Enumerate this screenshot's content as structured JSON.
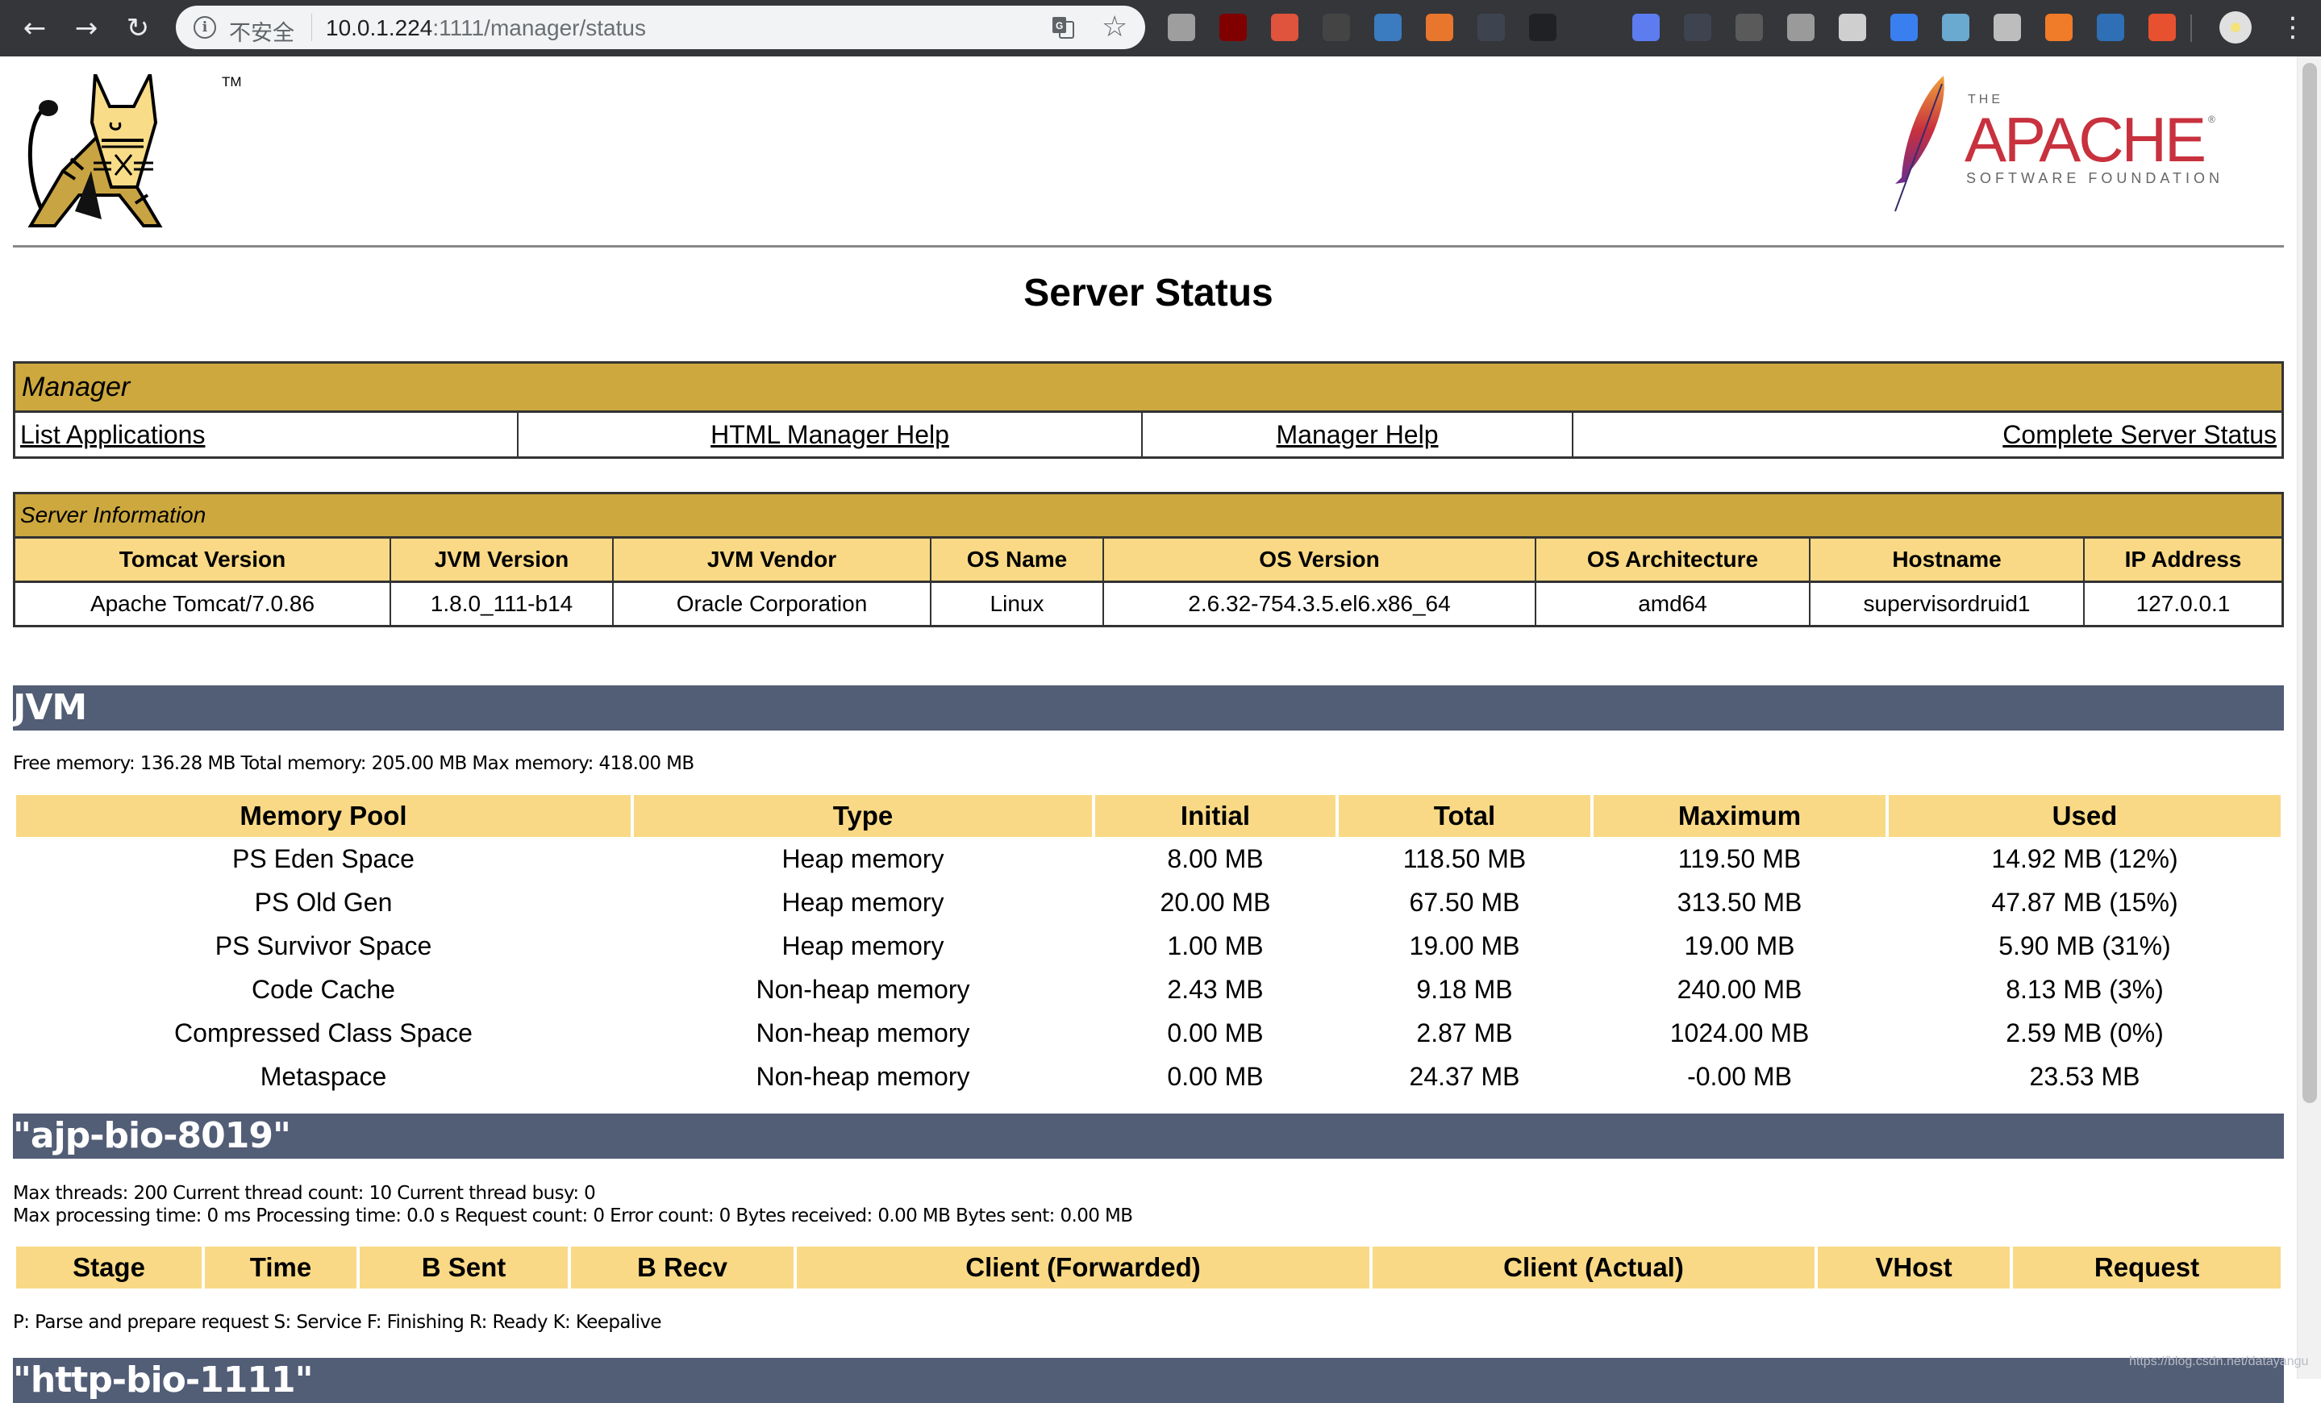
{
  "browser": {
    "back_icon": "arrow-left-icon",
    "forward_icon": "arrow-right-icon",
    "reload_icon": "reload-icon",
    "security_label": "不安全",
    "url_host": "10.0.1.224",
    "url_rest": ":1111/manager/status",
    "extensions": [
      {
        "name": "green-circle-extension-icon",
        "color": "#9e9e9e"
      },
      {
        "name": "ublock-extension-icon",
        "color": "#800000"
      },
      {
        "name": "infinity-extension-icon",
        "color": "#e0533d"
      },
      {
        "name": "bookmark-extension-icon",
        "color": "#444444"
      },
      {
        "name": "s-extension-icon",
        "color": "#3b7bc0"
      },
      {
        "name": "arrow-extension-icon",
        "color": "#e8762d"
      },
      {
        "name": "dots-extension-icon",
        "color": "#3d4450"
      },
      {
        "name": "glasses-box-extension-icon",
        "color": "#202124"
      },
      {
        "name": "sunglasses-extension-icon",
        "color": "#35363a"
      },
      {
        "name": "jh-extension-icon",
        "color": "#5c7cf0"
      },
      {
        "name": "recycle-extension-icon",
        "color": "#3d4450"
      },
      {
        "name": "off-extension-icon",
        "color": "#5a5a5a"
      },
      {
        "name": "parachute-extension-icon",
        "color": "#9a9a9a"
      },
      {
        "name": "white-circle-extension-icon",
        "color": "#cfcfcf"
      },
      {
        "name": "blue-diamond-extension-icon",
        "color": "#3a7ff0"
      },
      {
        "name": "eye-extension-icon",
        "color": "#6aa9d0"
      },
      {
        "name": "c-extension-icon",
        "color": "#bdbdbd"
      },
      {
        "name": "fox-extension-icon",
        "color": "#f07b28"
      },
      {
        "name": "slashes-extension-icon",
        "color": "#2e6fb5"
      },
      {
        "name": "asterisk-extension-icon",
        "color": "#e8512f"
      }
    ],
    "profile_icon": "profile-avatar-icon",
    "menu_icon": "kebab-menu-icon"
  },
  "header": {
    "tomcat_logo": "tomcat-logo",
    "tm": "TM",
    "apache_the": "THE",
    "apache_name": "APACHE",
    "apache_reg": "®",
    "apache_sub": "SOFTWARE FOUNDATION",
    "title": "Server Status"
  },
  "manager": {
    "heading": "Manager",
    "links": [
      "List Applications",
      "HTML Manager Help",
      "Manager Help",
      "Complete Server Status"
    ]
  },
  "server_info": {
    "heading": "Server Information",
    "columns": [
      "Tomcat Version",
      "JVM Version",
      "JVM Vendor",
      "OS Name",
      "OS Version",
      "OS Architecture",
      "Hostname",
      "IP Address"
    ],
    "values": [
      "Apache Tomcat/7.0.86",
      "1.8.0_111-b14",
      "Oracle Corporation",
      "Linux",
      "2.6.32-754.3.5.el6.x86_64",
      "amd64",
      "supervisordruid1",
      "127.0.0.1"
    ]
  },
  "jvm": {
    "heading": "JVM",
    "summary": "Free memory: 136.28 MB Total memory: 205.00 MB Max memory: 418.00 MB",
    "columns": [
      "Memory Pool",
      "Type",
      "Initial",
      "Total",
      "Maximum",
      "Used"
    ],
    "rows": [
      [
        "PS Eden Space",
        "Heap memory",
        "8.00 MB",
        "118.50 MB",
        "119.50 MB",
        "14.92 MB (12%)"
      ],
      [
        "PS Old Gen",
        "Heap memory",
        "20.00 MB",
        "67.50 MB",
        "313.50 MB",
        "47.87 MB (15%)"
      ],
      [
        "PS Survivor Space",
        "Heap memory",
        "1.00 MB",
        "19.00 MB",
        "19.00 MB",
        "5.90 MB (31%)"
      ],
      [
        "Code Cache",
        "Non-heap memory",
        "2.43 MB",
        "9.18 MB",
        "240.00 MB",
        "8.13 MB (3%)"
      ],
      [
        "Compressed Class Space",
        "Non-heap memory",
        "0.00 MB",
        "2.87 MB",
        "1024.00 MB",
        "2.59 MB (0%)"
      ],
      [
        "Metaspace",
        "Non-heap memory",
        "0.00 MB",
        "24.37 MB",
        "-0.00 MB",
        "23.53 MB"
      ]
    ]
  },
  "connector_ajp": {
    "heading": "\"ajp-bio-8019\"",
    "threads_line": "Max threads: 200 Current thread count: 10 Current thread busy: 0",
    "processing_line": "Max processing time: 0 ms Processing time: 0.0 s Request count: 0 Error count: 0 Bytes received: 0.00 MB Bytes sent: 0.00 MB",
    "columns": [
      "Stage",
      "Time",
      "B Sent",
      "B Recv",
      "Client (Forwarded)",
      "Client (Actual)",
      "VHost",
      "Request"
    ],
    "legend": "P: Parse and prepare request S: Service F: Finishing R: Ready K: Keepalive"
  },
  "connector_http": {
    "heading": "\"http-bio-1111\""
  },
  "watermark": "https://blog.csdn.net/datayangu"
}
